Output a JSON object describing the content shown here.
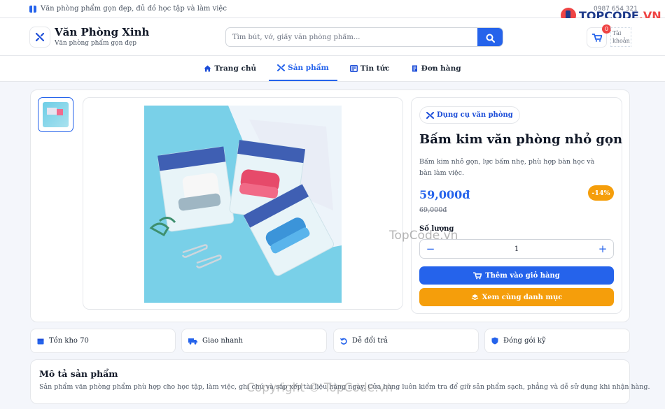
{
  "topbar": {
    "promo": "Văn phòng phẩm gọn đẹp, đủ đồ học tập và làm việc",
    "phone": "0987 654 321"
  },
  "watermark": {
    "logo_a": "TOPCODE",
    "logo_b": ".VN",
    "center": "TopCode.vn",
    "bottom": "Copyright © TopCode.vn"
  },
  "brand": {
    "name": "Văn Phòng Xinh",
    "tagline": "Văn phòng phẩm gọn đẹp"
  },
  "search": {
    "placeholder": "Tìm bút, vở, giấy văn phòng phẩm..."
  },
  "cart": {
    "count": "0"
  },
  "account": {
    "alt": "Tài khoản"
  },
  "nav": {
    "items": [
      {
        "label": "Trang chủ",
        "icon": "home-icon"
      },
      {
        "label": "Sản phẩm",
        "icon": "tools-icon",
        "active": true
      },
      {
        "label": "Tin tức",
        "icon": "news-icon"
      },
      {
        "label": "Đơn hàng",
        "icon": "receipt-icon"
      }
    ]
  },
  "product": {
    "category": "Dụng cụ văn phòng",
    "title": "Bấm kim văn phòng nhỏ gọn",
    "description": "Bấm kim nhỏ gọn, lực bấm nhẹ, phù hợp bàn học và bàn làm việc.",
    "price": "59,000đ",
    "old_price": "69,000đ",
    "discount": "-14%",
    "qty_label": "Số lượng",
    "qty_value": "1",
    "qty_minus": "−",
    "qty_plus": "+",
    "add_to_cart": "Thêm vào giỏ hàng",
    "view_category": "Xem cùng danh mục"
  },
  "features": [
    {
      "label": "Tồn kho 70",
      "icon": "calendar-icon"
    },
    {
      "label": "Giao nhanh",
      "icon": "truck-icon"
    },
    {
      "label": "Dễ đổi trả",
      "icon": "return-icon"
    },
    {
      "label": "Đóng gói kỹ",
      "icon": "shield-icon"
    }
  ],
  "description": {
    "title": "Mô tả sản phẩm",
    "text": "Sản phẩm văn phòng phẩm phù hợp cho học tập, làm việc, ghi chú và sắp xếp tài liệu hằng ngày. Cửa hàng luôn kiểm tra để giữ sản phẩm sạch, phẳng và dễ sử dụng khi nhận hàng."
  },
  "colors": {
    "primary": "#2563eb",
    "accent": "#f59e0b",
    "badge": "#ef4444"
  }
}
